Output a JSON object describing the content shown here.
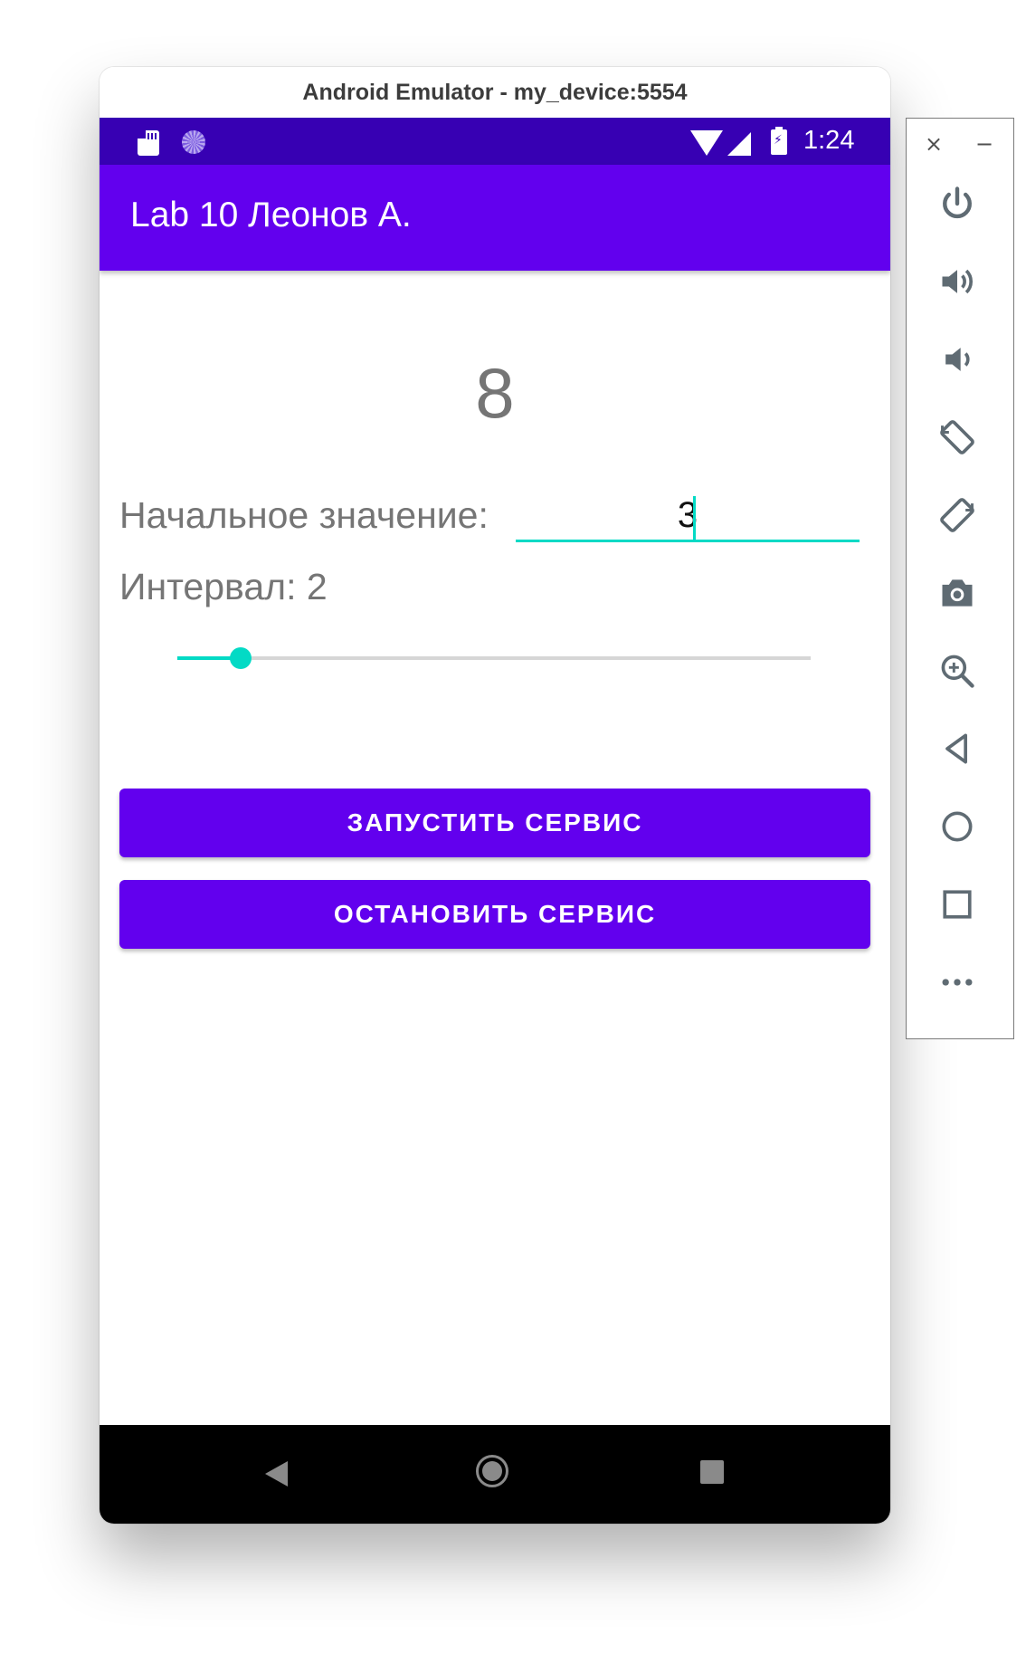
{
  "window": {
    "title": "Android Emulator - my_device:5554"
  },
  "status_bar": {
    "time": "1:24",
    "icons": [
      "sd-card-icon",
      "loader-icon",
      "wifi-icon",
      "signal-icon",
      "battery-charging-icon"
    ]
  },
  "app": {
    "title": "Lab 10 Леонов А.",
    "counter_value": "8",
    "start_label": "Начальное значение:",
    "start_value": "3",
    "interval_label": "Интервал: 2",
    "slider": {
      "value": 0.1
    },
    "buttons": {
      "start": "ЗАПУСТИТЬ СЕРВИС",
      "stop": "ОСТАНОВИТЬ СЕРВИС"
    }
  },
  "nav_bar": {
    "icons": [
      "back-icon",
      "home-icon",
      "recents-icon"
    ]
  },
  "side_toolbar": {
    "close": "×",
    "minimize": "−",
    "icons": [
      "power-icon",
      "volume-up-icon",
      "volume-down-icon",
      "rotate-left-icon",
      "rotate-right-icon",
      "camera-icon",
      "zoom-icon",
      "back-icon",
      "home-icon",
      "overview-icon",
      "more-icon"
    ]
  },
  "colors": {
    "primary": "#6200ee",
    "primary_dark": "#3700b3",
    "accent": "#03dac5",
    "text_secondary": "#757575",
    "toolbar_icon": "#5f6b73"
  }
}
